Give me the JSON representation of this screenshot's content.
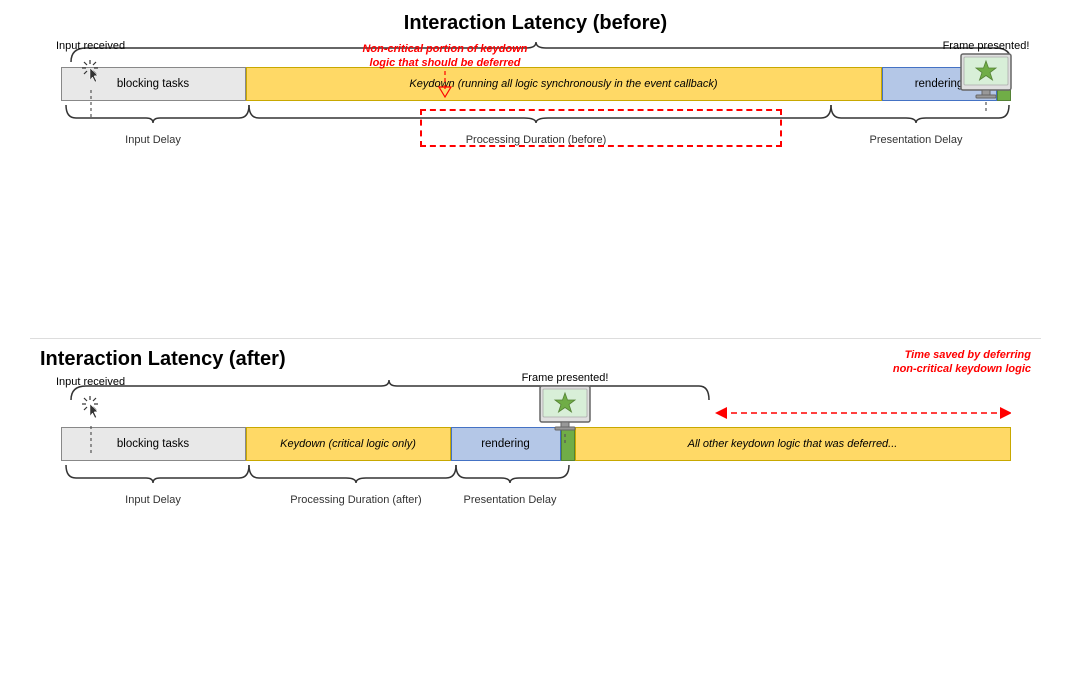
{
  "top": {
    "title": "Interaction Latency (before)",
    "inputReceived": "Input received",
    "framePresented": "Frame presented!",
    "blockingTasks": "blocking tasks",
    "keydownLabel": "Keydown (running all logic synchronously in the event callback)",
    "renderingLabel": "rendering",
    "redNote": "Non-critical portion of keydown\nlogic that should be deferred",
    "inputDelay": "Input Delay",
    "processingDuration": "Processing Duration (before)",
    "presentationDelay": "Presentation Delay"
  },
  "bottom": {
    "title": "Interaction Latency (after)",
    "inputReceived": "Input received",
    "framePresented": "Frame presented!",
    "blockingTasks": "blocking tasks",
    "keydownLabel": "Keydown (critical logic only)",
    "renderingLabel": "rendering",
    "deferredLabel": "All other keydown logic that was deferred...",
    "timeSaved": "Time saved by deferring\nnon-critical keydown logic",
    "inputDelay": "Input Delay",
    "processingDuration": "Processing Duration (after)",
    "presentationDelay": "Presentation Delay"
  },
  "colors": {
    "blocking": "#e8e8e8",
    "keydown": "#ffd966",
    "rendering": "#b4c7e7",
    "green": "#70ad47",
    "red": "#e00000"
  }
}
